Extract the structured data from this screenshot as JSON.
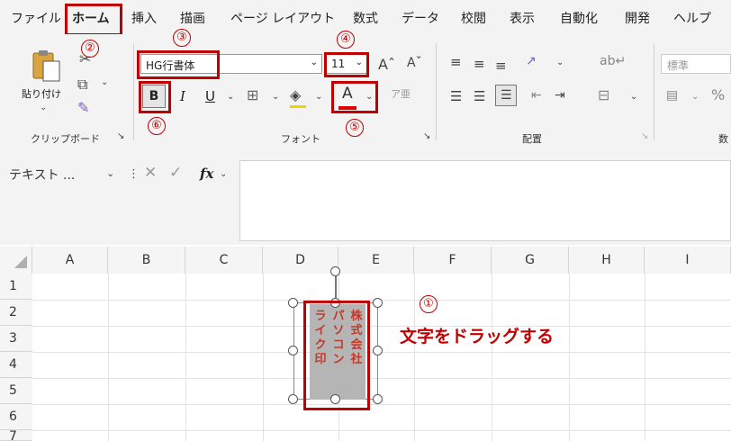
{
  "menu": {
    "items": [
      "ファイル",
      "ホーム",
      "挿入",
      "描画",
      "ページ レイアウト",
      "数式",
      "データ",
      "校閲",
      "表示",
      "自動化",
      "開発",
      "ヘルプ"
    ]
  },
  "ribbon": {
    "clipboard": {
      "paste_label": "貼り付け",
      "group_label": "クリップボード"
    },
    "font": {
      "font_name": "HG行書体",
      "font_size": "11",
      "bold": "B",
      "italic": "I",
      "underline": "U",
      "group_label": "フォント"
    },
    "align": {
      "group_label": "配置"
    },
    "number": {
      "format": "標準",
      "partial_label": "数"
    }
  },
  "callouts": [
    "①",
    "②",
    "③",
    "④",
    "⑤",
    "⑥"
  ],
  "formula_bar": {
    "name_box": "テキスト ...",
    "fx": "fx"
  },
  "columns": [
    "A",
    "B",
    "C",
    "D",
    "E",
    "F",
    "G",
    "H",
    "I"
  ],
  "rows": [
    "1",
    "2",
    "3",
    "4",
    "5",
    "6",
    "7"
  ],
  "textbox": {
    "columns": [
      "株式会社",
      "パソコン",
      "ライク印"
    ]
  },
  "annotation": "文字をドラッグする",
  "colors": {
    "accent_red": "#c00000",
    "text_red": "#c0392b"
  }
}
